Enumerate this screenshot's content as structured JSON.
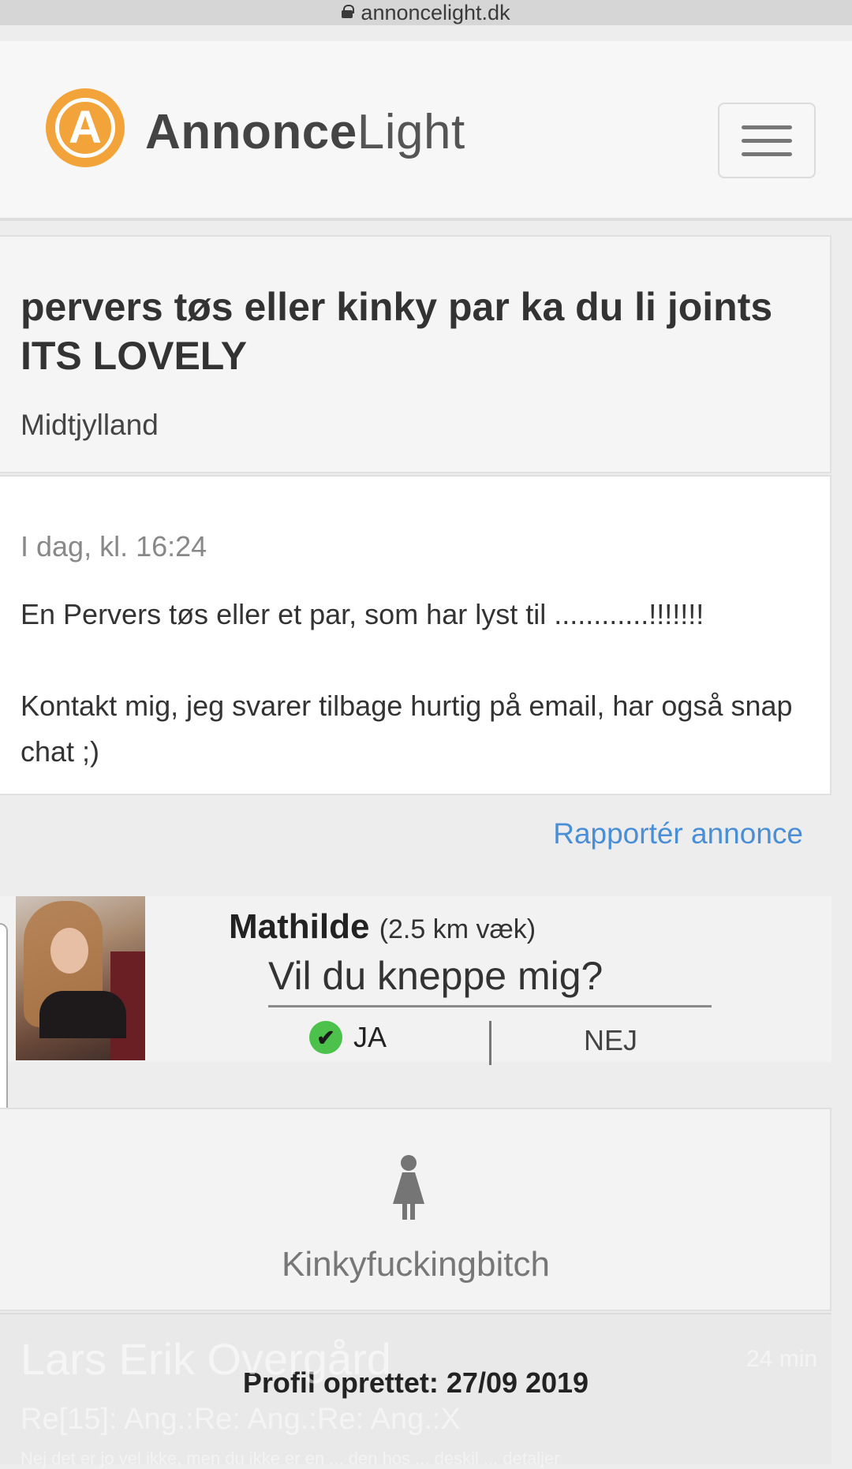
{
  "browser": {
    "url": "annoncelight.dk"
  },
  "header": {
    "logo_letter": "A",
    "logo_bold": "Annonce",
    "logo_light": "Light"
  },
  "ad": {
    "title": "pervers tøs eller kinky par ka du li joints ITS LOVELY",
    "region": "Midtjylland",
    "date": "I dag, kl. 16:24",
    "text": "En Pervers tøs eller et par, som har lyst til ............!!!!!!!\n\nKontakt mig, jeg svarer tilbage hurtig på email, har også snap chat ;)",
    "report_label": "Rapportér annonce"
  },
  "promo": {
    "name": "Mathilde",
    "distance": "(2.5 km væk)",
    "question": "Vil du kneppe mig?",
    "yes_label": "JA",
    "no_label": "NEJ"
  },
  "profile": {
    "username": "Kinkyfuckingbitch",
    "created": "Profil oprettet: 27/09 2019"
  },
  "notification": {
    "sender": "Lars Erik Overgård",
    "time": "24 min",
    "subject": "Re[15]: Ang.:Re: Ang.:Re: Ang.:X",
    "preview": "Nej det er jo vel ikke, men du ikke er en ... den hos ... deskil ... detaljer"
  }
}
